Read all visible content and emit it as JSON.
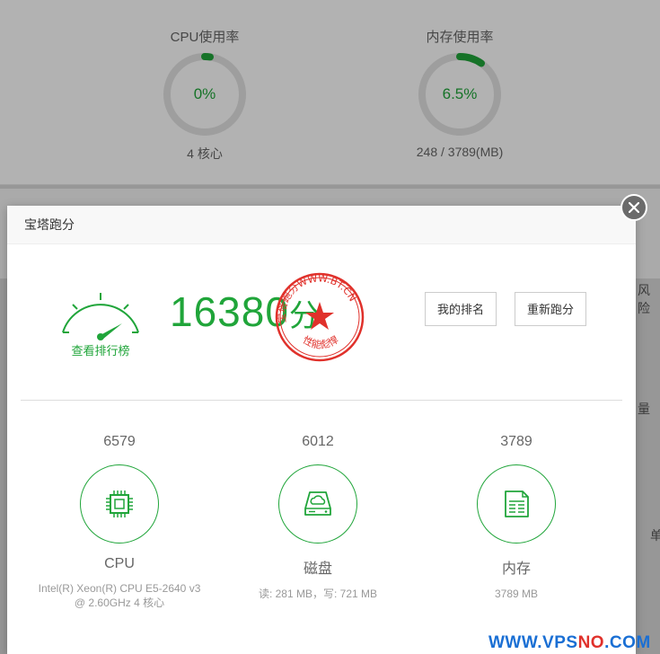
{
  "background": {
    "cpu_gauge": {
      "label": "CPU使用率",
      "value": "0%",
      "sub": "4 核心",
      "percent": 0
    },
    "mem_gauge": {
      "label": "内存使用率",
      "value": "6.5%",
      "sub": "248 / 3789(MB)",
      "percent": 6.5
    },
    "side_texts": [
      "风险",
      "量",
      "单"
    ]
  },
  "modal": {
    "title": "宝塔跑分",
    "gauge_link": "查看排行榜",
    "score": "16380",
    "score_unit": "分",
    "stamp": {
      "top_text": "宝塔跑分WWW.BT.CN",
      "bottom_text": "性能彪悍"
    },
    "buttons": {
      "rank": "我的排名",
      "rerun": "重新跑分"
    },
    "items": [
      {
        "score": "6579",
        "name": "CPU",
        "icon": "cpu-chip-icon",
        "detail": "Intel(R) Xeon(R) CPU E5-2640 v3 @ 2.60GHz 4 核心"
      },
      {
        "score": "6012",
        "name": "磁盘",
        "icon": "hard-disk-icon",
        "detail": "读: 281 MB，写: 721 MB"
      },
      {
        "score": "3789",
        "name": "内存",
        "icon": "memory-document-icon",
        "detail": "3789 MB"
      }
    ]
  },
  "watermark": {
    "part1": "WWW.VPS",
    "part2": "NO",
    "part3": ".COM"
  },
  "colors": {
    "accent": "#20a53a",
    "stamp": "#e0312b",
    "watermark_blue": "#1a6fd4"
  }
}
